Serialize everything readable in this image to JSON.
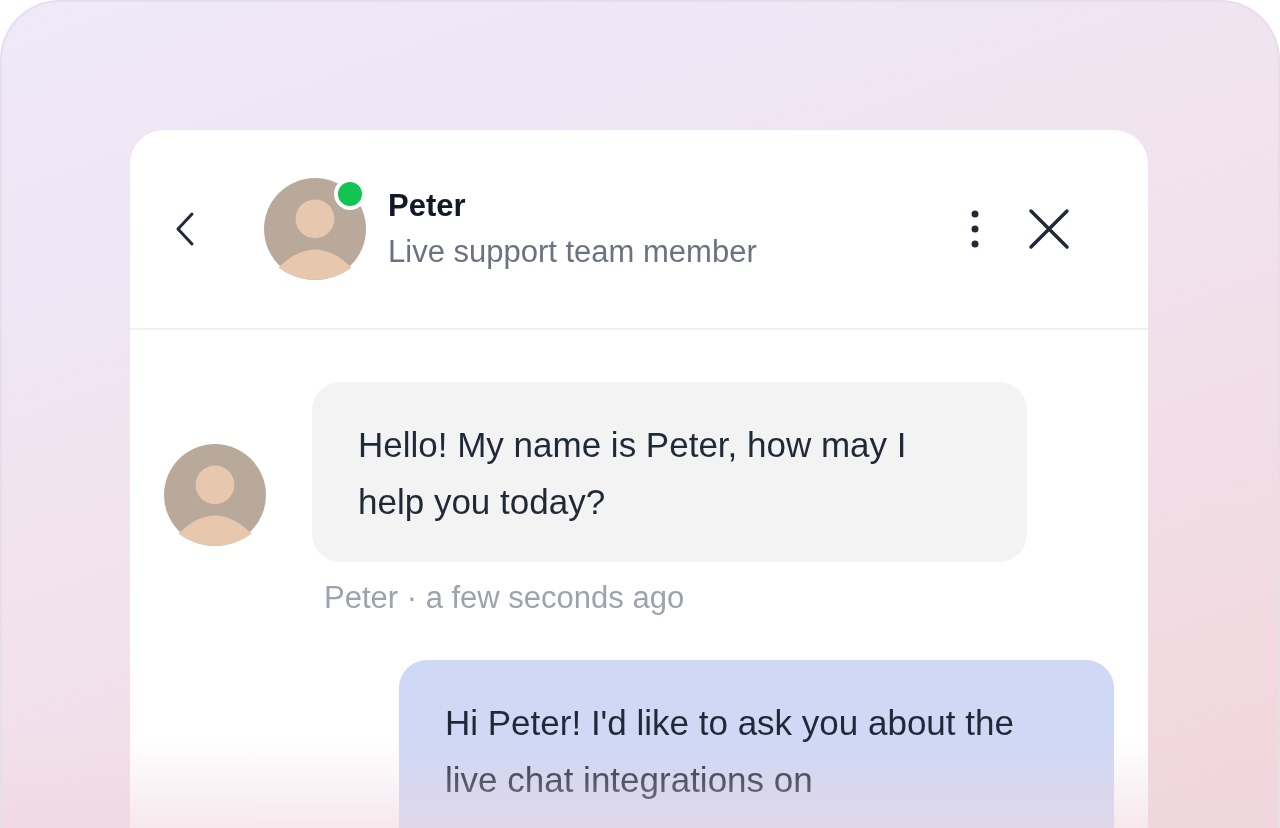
{
  "header": {
    "name": "Peter",
    "subtitle": "Live support team member",
    "online": true
  },
  "messages": [
    {
      "kind": "agent",
      "text": "Hello! My name is Peter, how may I help you today?",
      "meta": "Peter · a few seconds ago"
    },
    {
      "kind": "user",
      "text": "Hi Peter! I'd like to ask you about the live chat integrations on"
    }
  ]
}
